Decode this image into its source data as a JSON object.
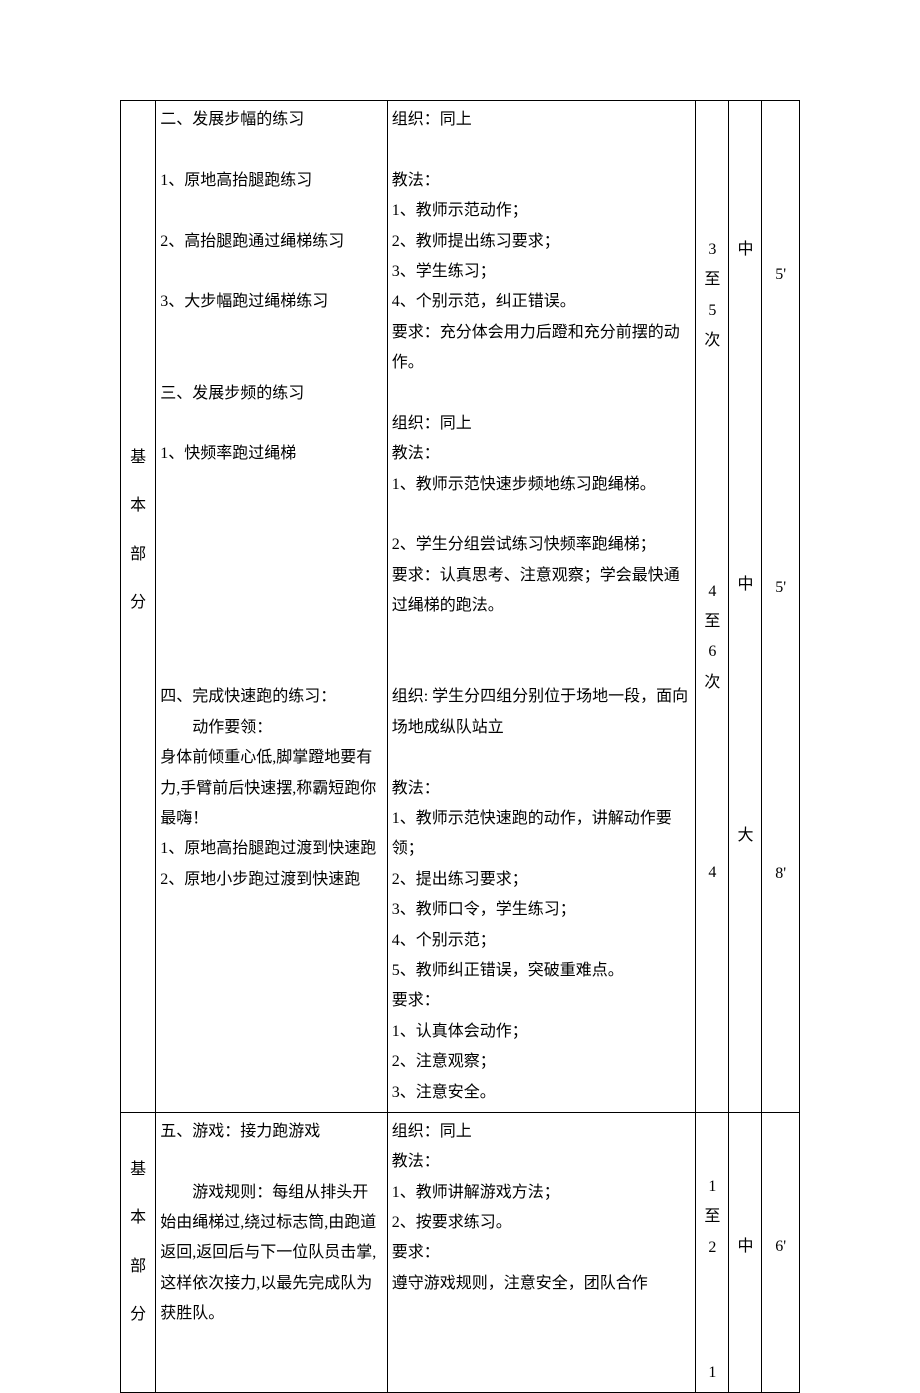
{
  "row1": {
    "label_chars": [
      "基",
      "本",
      "部",
      "分"
    ],
    "content": {
      "sec2_title": "二、发展步幅的练习",
      "sec2_items": [
        "1、原地高抬腿跑练习",
        "2、高抬腿跑通过绳梯练习",
        "3、大步幅跑过绳梯练习"
      ],
      "sec3_title": "三、发展步频的练习",
      "sec3_items": [
        "1、快频率跑过绳梯"
      ],
      "sec4_title": "四、完成快速跑的练习：",
      "sec4_sub": "动作要领：",
      "sec4_desc": "身体前倾重心低,脚掌蹬地要有力,手臂前后快速摆,称霸短跑你最嗨！",
      "sec4_items": [
        "1、原地高抬腿跑过渡到快速跑",
        "2、原地小步跑过渡到快速跑"
      ]
    },
    "method": {
      "m2_org": "组织：同上",
      "m2_fa": "教法：",
      "m2_items": [
        "1、教师示范动作；",
        "2、教师提出练习要求；",
        "3、学生练习；",
        "4、个别示范，纠正错误。"
      ],
      "m2_req": "要求：充分体会用力后蹬和充分前摆的动作。",
      "m3_org": "组织：同上",
      "m3_fa": "教法：",
      "m3_item1": "1、教师示范快速步频地练习跑绳梯。",
      "m3_item2": "2、学生分组尝试练习快频率跑绳梯；",
      "m3_req": "要求：认真思考、注意观察；学会最快通过绳梯的跑法。",
      "m4_org": "组织: 学生分四组分别位于场地一段，面向场地成纵队站立",
      "m4_fa": "教法：",
      "m4_items": [
        "1、教师示范快速跑的动作，讲解动作要领；",
        "2、提出练习要求；",
        "3、教师口令，学生练习；",
        "4、个别示范；",
        "5、教师纠正错误，突破重难点。"
      ],
      "m4_req_title": "要求：",
      "m4_req_items": [
        "1、认真体会动作；",
        "2、注意观察；",
        "3、注意安全。"
      ]
    },
    "counts": {
      "c2": "3\n至\n5\n次",
      "c3": "4\n至\n6\n次",
      "c4": "4"
    },
    "intensity": {
      "i2": "中",
      "i3": "中",
      "i4": "大"
    },
    "time": {
      "t2": "5'",
      "t3": "5'",
      "t4": "8'"
    }
  },
  "row2": {
    "label_chars": [
      "基",
      "本",
      "部",
      "分"
    ],
    "content": {
      "sec5_title": "五、游戏：接力跑游戏",
      "sec5_rule": "　　游戏规则：每组从排头开始由绳梯过,绕过标志筒,由跑道返回,返回后与下一位队员击掌,这样依次接力,以最先完成队为获胜队。"
    },
    "method": {
      "m5_org": "组织：同上",
      "m5_fa": "教法：",
      "m5_items": [
        "1、教师讲解游戏方法；",
        "2、按要求练习。"
      ],
      "m5_req_title": "要求：",
      "m5_req": "遵守游戏规则，注意安全，团队合作"
    },
    "counts": {
      "c5": "1\n至\n2",
      "c_extra": "1"
    },
    "intensity": {
      "i5": "中"
    },
    "time": {
      "t5": "6'"
    }
  }
}
